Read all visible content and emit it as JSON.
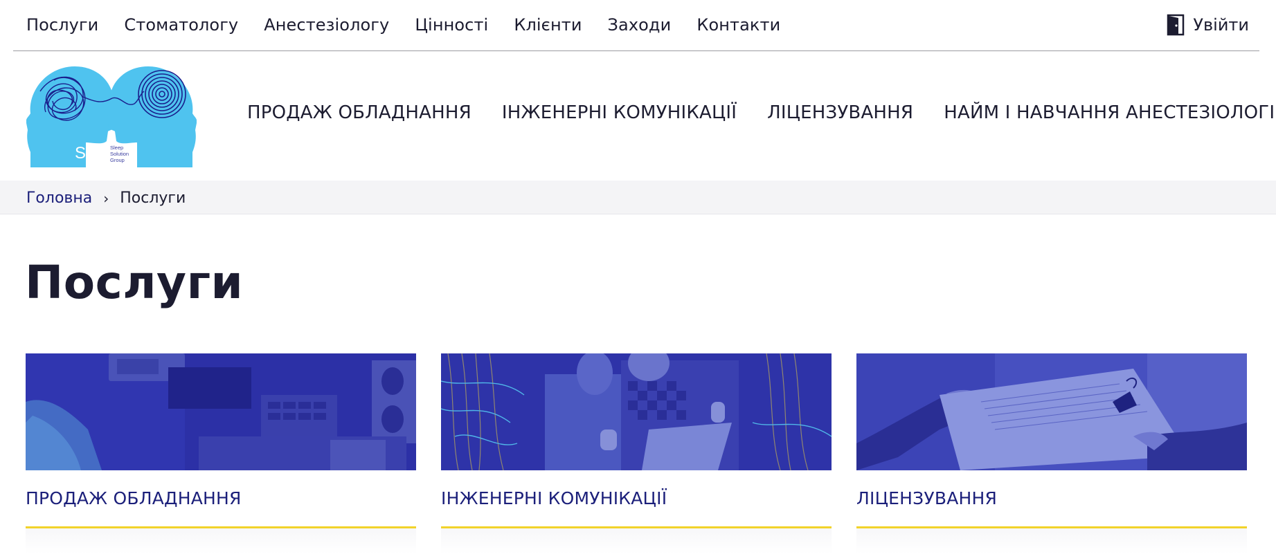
{
  "top_nav": {
    "items": [
      "Послуги",
      "Стоматологу",
      "Анестезіологу",
      "Цінності",
      "Клієнти",
      "Заходи",
      "Контакти"
    ],
    "login_label": "Увійти",
    "login_icon": "door-icon"
  },
  "logo": {
    "letters": "SSG",
    "tagline": [
      "Sleep",
      "Solution",
      "Group"
    ],
    "color": "#4fc3ef",
    "line_color": "#1a1e8c"
  },
  "main_nav": {
    "items": [
      "ПРОДАЖ ОБЛАДНАННЯ",
      "ІНЖЕНЕРНІ КОМУНІКАЦІЇ",
      "ЛІЦЕНЗУВАННЯ",
      "НАЙМ І НАВЧАННЯ АНЕСТЕЗІОЛОГІВ"
    ]
  },
  "breadcrumb": {
    "home": "Головна",
    "separator": "›",
    "current": "Послуги"
  },
  "page": {
    "title": "Послуги"
  },
  "cards": [
    {
      "title": "ПРОДАЖ ОБЛАДНАННЯ"
    },
    {
      "title": "ІНЖЕНЕРНІ КОМУНІКАЦІЇ"
    },
    {
      "title": "ЛІЦЕНЗУВАННЯ"
    }
  ],
  "colors": {
    "accent_blue": "#1b1f7a",
    "accent_yellow": "#f2d32a",
    "overlay": "#2a2fa8"
  }
}
